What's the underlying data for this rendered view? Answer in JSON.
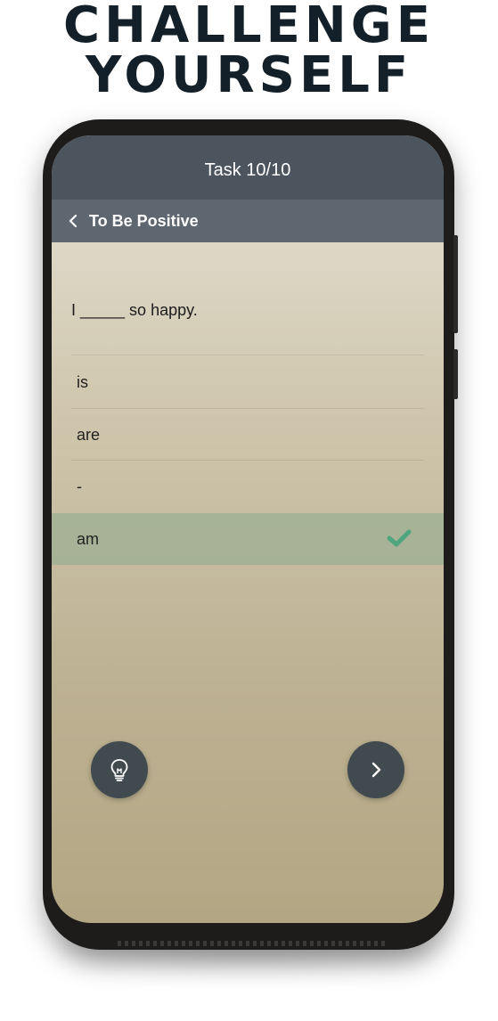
{
  "promo": {
    "line1": "CHALLENGE",
    "line2": "YOURSELF"
  },
  "app": {
    "header_title": "Task 10/10",
    "subheader": {
      "back_icon": "chevron-left-icon",
      "title": "To Be Positive"
    },
    "question": "I _____ so happy.",
    "options": [
      {
        "label": "is",
        "selected": false
      },
      {
        "label": "are",
        "selected": false
      },
      {
        "label": "-",
        "selected": false
      },
      {
        "label": "am",
        "selected": true
      }
    ],
    "selected_check_icon": "checkmark-icon",
    "hint_button_icon": "lightbulb-icon",
    "next_button_icon": "chevron-right-icon"
  },
  "colors": {
    "headline": "#132029",
    "header_bar": "#4c545e",
    "subheader_bar": "#5e666f",
    "selected_row": "#9eb094",
    "check": "#3fa37a",
    "round_buttons": "#414a4f"
  }
}
